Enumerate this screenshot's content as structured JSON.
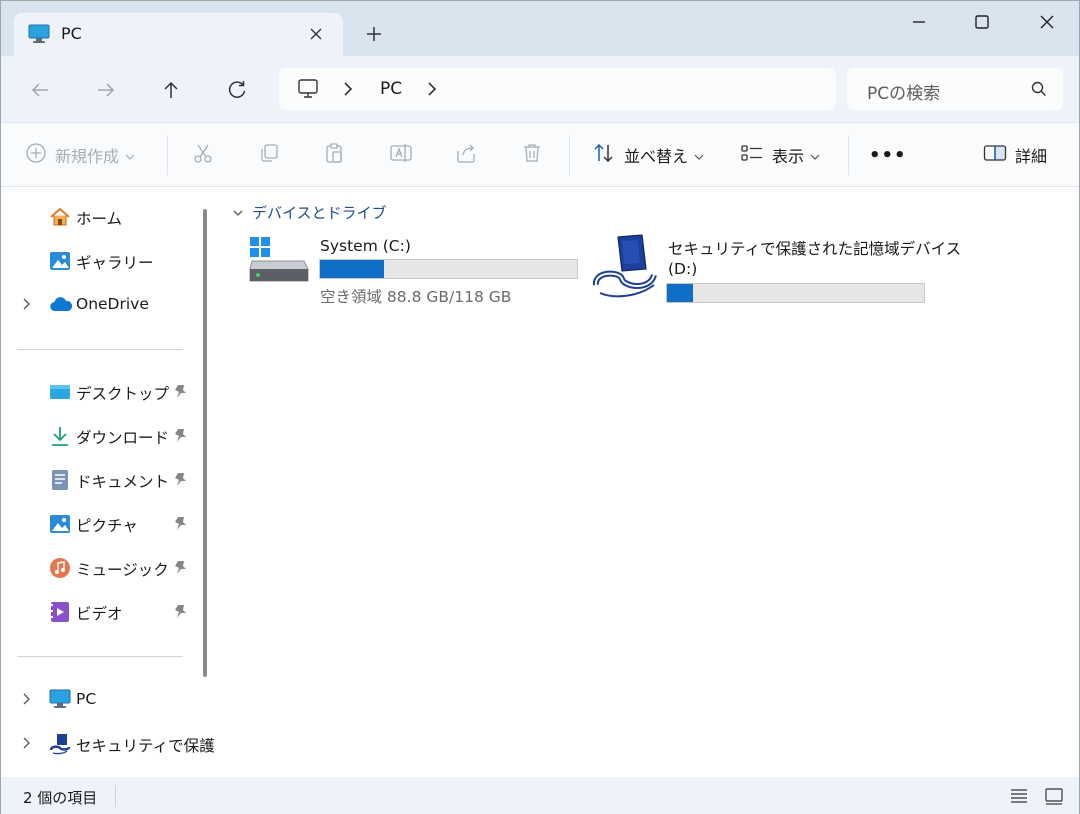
{
  "tab": {
    "title": "PC"
  },
  "address": {
    "segment": "PC"
  },
  "search": {
    "placeholder": "PCの検索"
  },
  "toolbar": {
    "new_label": "新規作成",
    "sort_label": "並べ替え",
    "view_label": "表示",
    "more_label": "•••",
    "details_label": "詳細"
  },
  "sidebar": {
    "items": [
      {
        "label": "ホーム"
      },
      {
        "label": "ギャラリー"
      },
      {
        "label": "OneDrive"
      },
      {
        "label": "デスクトップ"
      },
      {
        "label": "ダウンロード"
      },
      {
        "label": "ドキュメント"
      },
      {
        "label": "ピクチャ"
      },
      {
        "label": "ミュージック"
      },
      {
        "label": "ビデオ"
      },
      {
        "label": "PC"
      },
      {
        "label": "セキュリティで保護"
      }
    ]
  },
  "main": {
    "group_title": "デバイスとドライブ",
    "drives": [
      {
        "name": "System (C:)",
        "free_text": "空き領域 88.8 GB/118 GB",
        "used_fraction": 0.25
      },
      {
        "name": "セキュリティで保護された記憶域デバイス",
        "name_line2": "(D:)",
        "used_fraction": 0.1
      }
    ]
  },
  "status": {
    "item_count": "2 個の項目"
  },
  "colors": {
    "accent": "#0f6fc6",
    "tabbar": "#d9e4ef",
    "window": "#eef3f9"
  }
}
